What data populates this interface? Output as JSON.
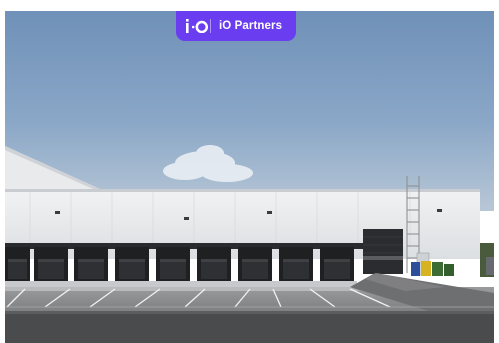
{
  "brand": {
    "logo_icon": "io-logo-icon",
    "name": "iO Partners",
    "color": "#6a3df0"
  },
  "photo": {
    "icon": "warehouse-loading-docks-photo"
  }
}
